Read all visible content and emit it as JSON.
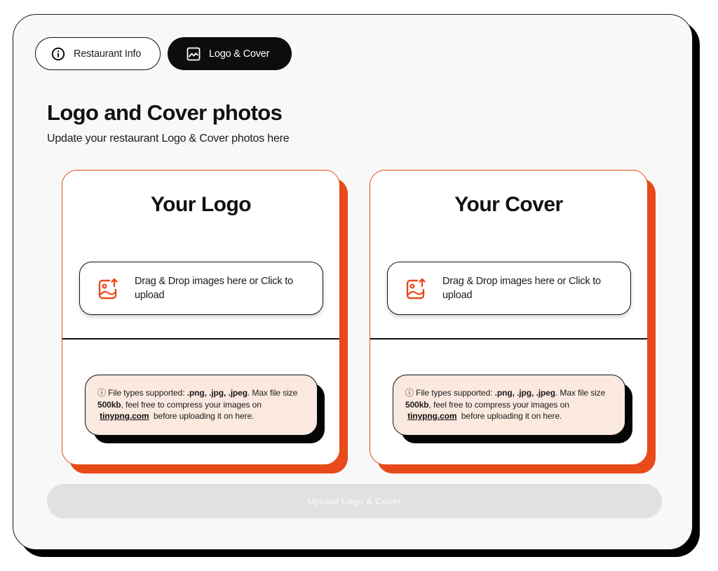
{
  "tabs": [
    {
      "label": "Restaurant Info",
      "icon": "info-icon",
      "active": false
    },
    {
      "label": "Logo & Cover",
      "icon": "image-icon",
      "active": true
    }
  ],
  "page": {
    "title": "Logo and Cover photos",
    "subtitle": "Update your restaurant Logo & Cover photos here"
  },
  "cards": [
    {
      "title": "Your Logo",
      "dropzone_text": "Drag & Drop images here or Click to upload",
      "note": {
        "prefix": "ⓘ File types supported: ",
        "types": ".png, .jpg, .jpeg",
        "mid": ". Max file size ",
        "size": "500kb",
        "after_size": ", feel free to compress your images on ",
        "link": "tinypng.com",
        "suffix": " before uploading it on here."
      }
    },
    {
      "title": "Your Cover",
      "dropzone_text": "Drag & Drop images here or Click to upload",
      "note": {
        "prefix": "ⓘ File types supported: ",
        "types": ".png, .jpg, .jpeg",
        "mid": ". Max file size ",
        "size": "500kb",
        "after_size": ", feel free to compress your images on ",
        "link": "tinypng.com",
        "suffix": " before uploading it on here."
      }
    }
  ],
  "upload_button": {
    "label": "Upload Logo & Cover",
    "disabled": true
  },
  "colors": {
    "accent": "#e84a1a",
    "note_bg": "#fbe9e0",
    "active_tab": "#0d0d0d",
    "disabled_button": "#e1e1e1"
  }
}
